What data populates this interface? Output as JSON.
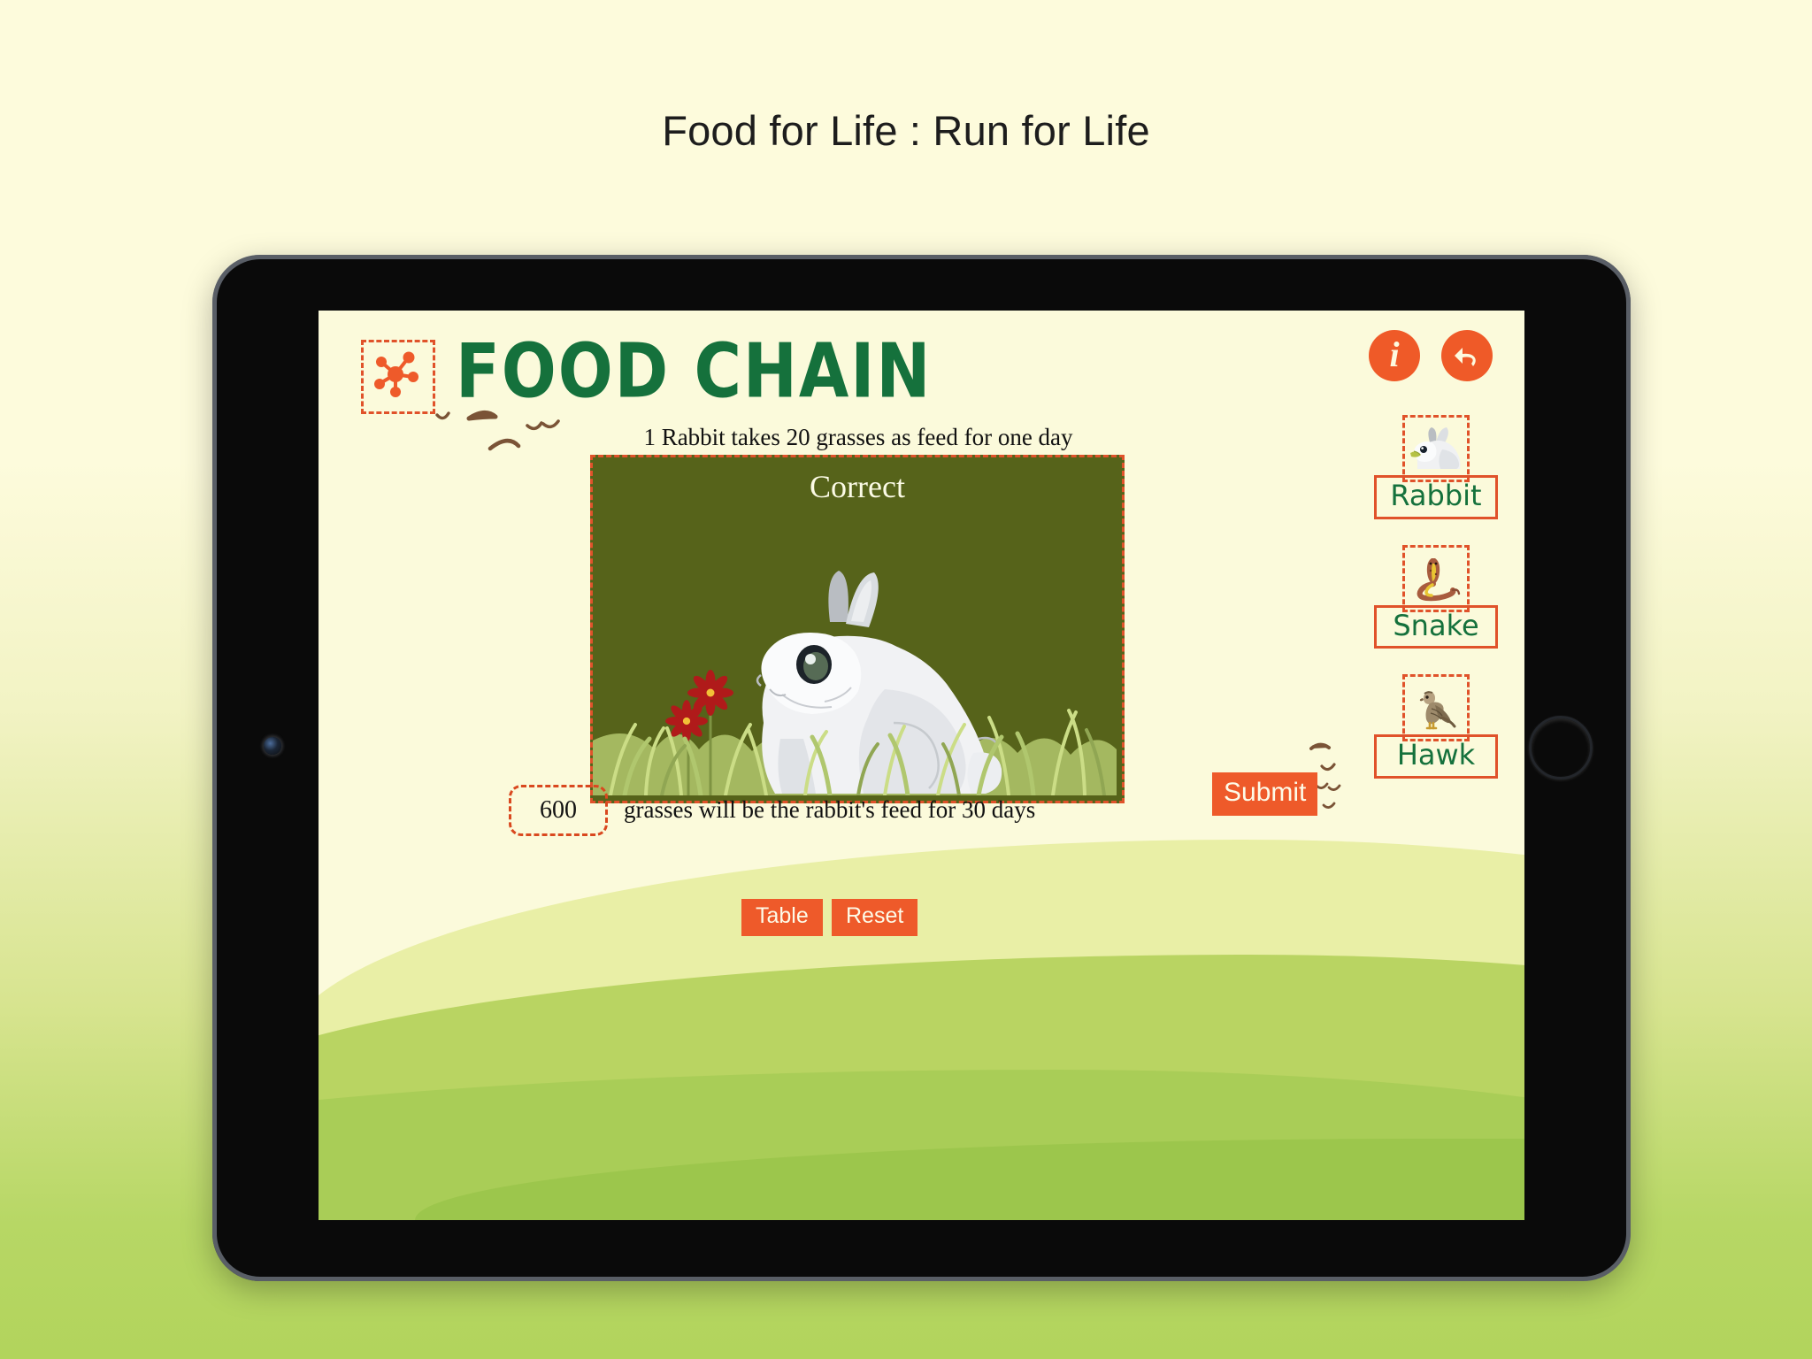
{
  "page": {
    "title": "Food for Life : Run for Life",
    "background_top": "#fdfbdc",
    "background_bottom": "#b2d45c"
  },
  "app": {
    "name": "FOOD CHAIN",
    "logo_icon": "network-nodes-icon",
    "accent_color": "#ee5a2a",
    "title_color": "#15713c",
    "screen_background": "#fbfadb"
  },
  "toolbar": {
    "info_label": "i",
    "info_icon": "info-icon",
    "undo_icon": "undo-icon"
  },
  "main": {
    "instruction": "1 Rabbit takes 20 grasses as feed for one day",
    "feedback": "Correct",
    "scene_background": "#56631a",
    "scene_subject": "rabbit-in-grass-illustration"
  },
  "answer": {
    "value": "600",
    "placeholder": "",
    "suffix_text": "grasses will be the rabbit's feed for 30 days",
    "submit_label": "Submit"
  },
  "controls": {
    "table_label": "Table",
    "reset_label": "Reset"
  },
  "palette": {
    "items": [
      {
        "label": "Rabbit",
        "icon": "rabbit-icon"
      },
      {
        "label": "Snake",
        "icon": "snake-icon"
      },
      {
        "label": "Hawk",
        "icon": "hawk-icon"
      }
    ]
  }
}
